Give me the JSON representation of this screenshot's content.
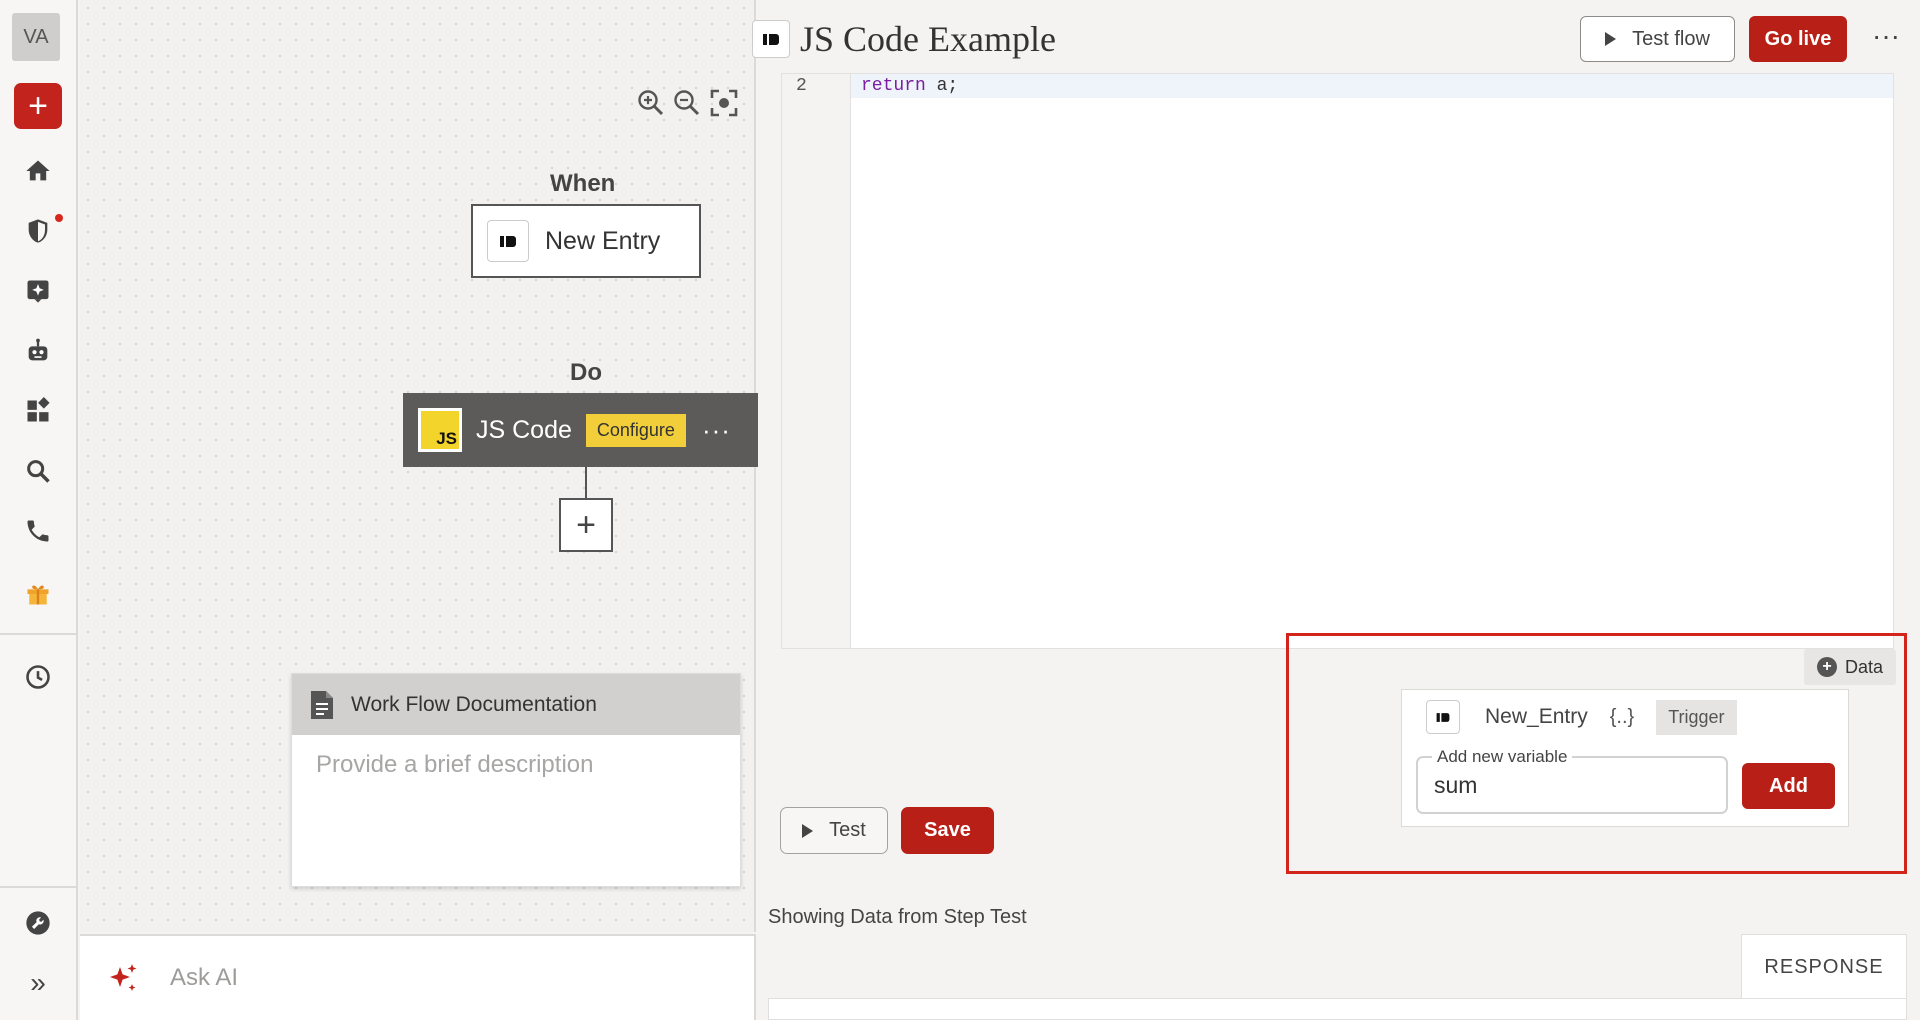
{
  "sidebar": {
    "avatar_initials": "VA",
    "create_label": "+",
    "items": [
      "home-icon",
      "shield-icon",
      "sparkle-icon",
      "robot-icon",
      "widgets-icon",
      "search-icon",
      "phone-icon",
      "gift-icon",
      "history-icon"
    ],
    "bottom": [
      "tool-icon",
      "expand-icon"
    ],
    "expand_label": "»"
  },
  "canvas": {
    "when_label": "When",
    "trigger_name": "New Entry",
    "do_label": "Do",
    "action_name": "JS Code",
    "action_logo_text": "JS",
    "action_badge": "Configure",
    "action_more": "···",
    "add_step": "+",
    "doc": {
      "title": "Work Flow Documentation",
      "placeholder": "Provide a brief description"
    },
    "ask_ai": "Ask AI"
  },
  "header": {
    "title": "JS Code Example",
    "test_flow": "Test flow",
    "go_live": "Go live",
    "more": "···"
  },
  "editor": {
    "line_number": "2",
    "keyword": "return",
    "code_rest": " a;"
  },
  "actions": {
    "test": "Test",
    "save": "Save"
  },
  "variables": {
    "data_button": "Data",
    "source_name": "New_Entry",
    "braces": "{..}",
    "source_type": "Trigger",
    "field_label": "Add new variable",
    "field_value": "sum",
    "add_button": "Add"
  },
  "results": {
    "heading": "Showing Data from Step Test",
    "response_tab": "RESPONSE"
  },
  "colors": {
    "brand_red": "#b82017",
    "highlight_red": "#d2241a",
    "configure_yellow": "#f2cf3a",
    "js_yellow": "#f2d42b"
  }
}
